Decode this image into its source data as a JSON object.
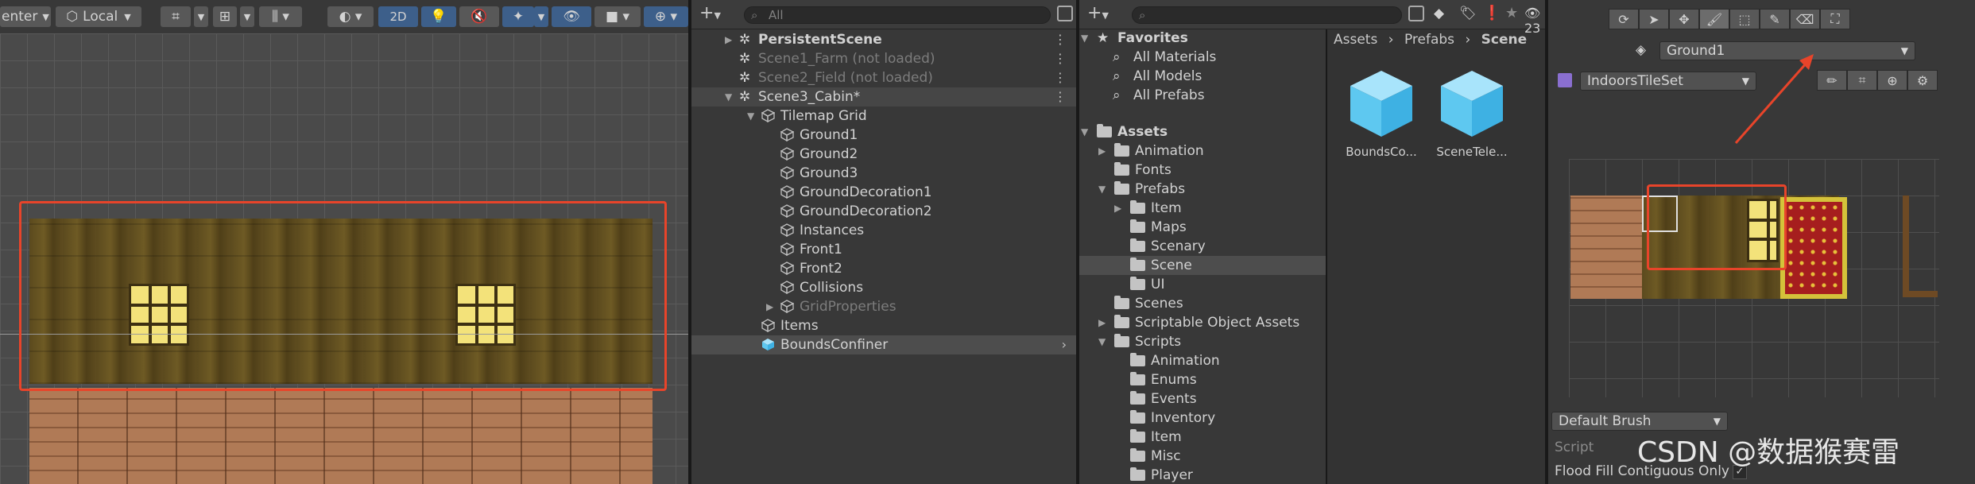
{
  "scene": {
    "toolbar": {
      "pivot_label": "enter",
      "space_label": "Local",
      "mode_2d": "2D"
    }
  },
  "hierarchy": {
    "search_placeholder": "All",
    "rows": [
      {
        "label": "PersistentScene",
        "style": "scene-bold"
      },
      {
        "label": "Scene1_Farm (not loaded)",
        "style": "scene-dim"
      },
      {
        "label": "Scene2_Field (not loaded)",
        "style": "scene-dim"
      },
      {
        "label": "Scene3_Cabin*",
        "style": "scene"
      },
      {
        "label": "Tilemap Grid",
        "style": "obj"
      },
      {
        "label": "Ground1",
        "style": "obj"
      },
      {
        "label": "Ground2",
        "style": "obj"
      },
      {
        "label": "Ground3",
        "style": "obj"
      },
      {
        "label": "GroundDecoration1",
        "style": "obj"
      },
      {
        "label": "GroundDecoration2",
        "style": "obj"
      },
      {
        "label": "Instances",
        "style": "obj"
      },
      {
        "label": "Front1",
        "style": "obj"
      },
      {
        "label": "Front2",
        "style": "obj"
      },
      {
        "label": "Collisions",
        "style": "obj"
      },
      {
        "label": "GridProperties",
        "style": "obj-dim"
      },
      {
        "label": "Items",
        "style": "obj"
      },
      {
        "label": "BoundsConfiner",
        "style": "prefab"
      }
    ]
  },
  "project": {
    "badge_count": "23",
    "favorites_label": "Favorites",
    "favorites": [
      "All Materials",
      "All Models",
      "All Prefabs"
    ],
    "tree": [
      {
        "label": "Assets",
        "bold": true
      },
      {
        "label": "Animation"
      },
      {
        "label": "Fonts"
      },
      {
        "label": "Prefabs"
      },
      {
        "label": "Item"
      },
      {
        "label": "Maps"
      },
      {
        "label": "Scenary"
      },
      {
        "label": "Scene"
      },
      {
        "label": "UI"
      },
      {
        "label": "Scenes"
      },
      {
        "label": "Scriptable Object Assets"
      },
      {
        "label": "Scripts"
      },
      {
        "label": "Animation"
      },
      {
        "label": "Enums"
      },
      {
        "label": "Events"
      },
      {
        "label": "Inventory"
      },
      {
        "label": "Item"
      },
      {
        "label": "Misc"
      },
      {
        "label": "Player"
      }
    ],
    "breadcrumb": [
      "Assets",
      "Prefabs",
      "Scene"
    ],
    "assets": [
      "BoundsCo...",
      "SceneTele..."
    ]
  },
  "palette": {
    "target_layer": "Ground1",
    "palette_name": "IndoorsTileSet",
    "brush": "Default Brush",
    "script_label": "Script",
    "flood_fill_label": "Flood Fill Contiguous Only"
  },
  "watermark": "CSDN @数据猴赛雷",
  "colors": {
    "highlight": "#e8442a",
    "selection": "#4d4d4d",
    "prefab_icon": "#5ec8f0"
  }
}
